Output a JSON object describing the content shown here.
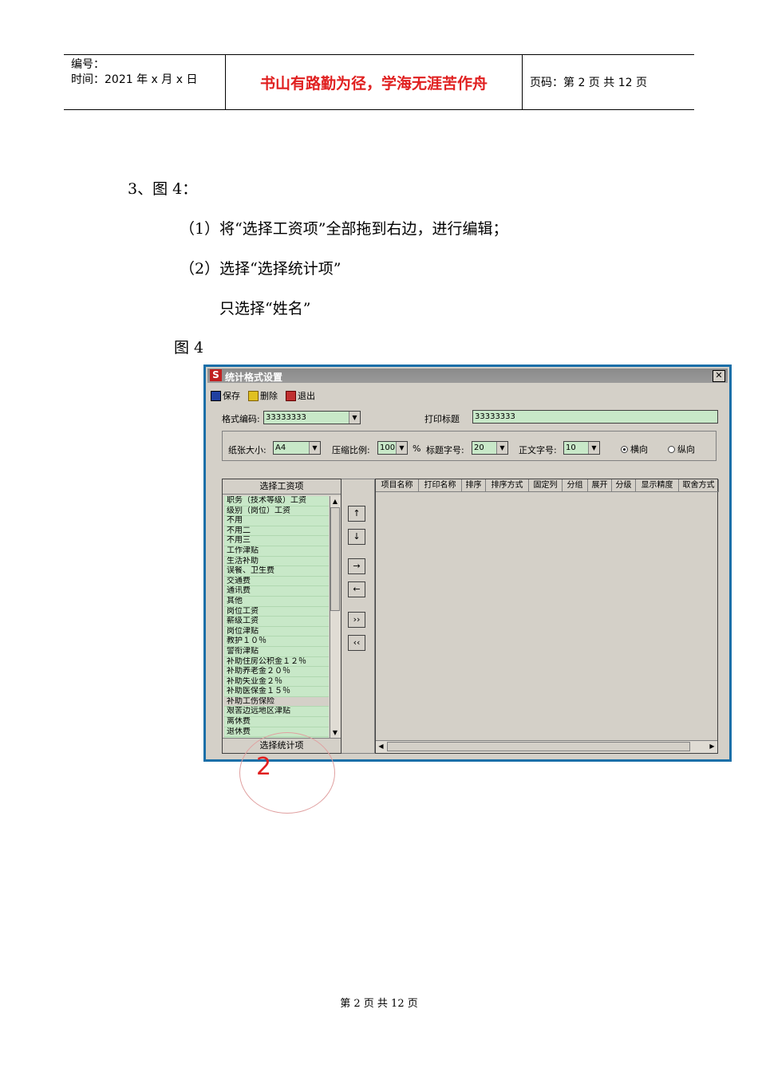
{
  "header": {
    "number_label": "编号：",
    "date_label": "时间：2021 年 x 月 x 日",
    "motto": "书山有路勤为径，学海无涯苦作舟",
    "page_info": "页码：第 2 页  共 12 页"
  },
  "content": {
    "step_title": "3、图 4：",
    "item1": "（1）将“选择工资项”全部拖到右边，进行编辑；",
    "item2": "（2）选择“选择统计项”",
    "item3": "只选择“姓名”",
    "figure_label": "图 4"
  },
  "window": {
    "title": "统计格式设置",
    "toolbar": {
      "save": "保存",
      "delete": "删除",
      "exit": "退出"
    },
    "format_code_label": "格式编码:",
    "format_code_value": "33333333",
    "print_title_label": "打印标题",
    "print_title_value": "33333333",
    "paper_size_label": "纸张大小:",
    "paper_size_value": "A4",
    "zoom_label": "压缩比例:",
    "zoom_value": "100",
    "zoom_unit": "%",
    "title_font_label": "标题字号:",
    "title_font_value": "20",
    "body_font_label": "正文字号:",
    "body_font_value": "10",
    "orientation_landscape": "横向",
    "orientation_portrait": "纵向",
    "left_panel_title": "选择工资项",
    "left_panel_footer": "选择统计项",
    "wage_items": [
      "职务（技术等级）工资",
      "级别（岗位）工资",
      "不用",
      "不用二",
      "不用三",
      "工作津贴",
      "生活补助",
      "误餐、卫生费",
      "交通费",
      "通讯费",
      "其他",
      "岗位工资",
      "薪级工资",
      "岗位津贴",
      "教护１０％",
      "警衔津贴",
      "补助住房公积金１２％",
      "补助养老金２０％",
      "补助失业金２％",
      "补助医保金１５％",
      "补助工伤保险",
      "艰苦边远地区津贴",
      "离休费",
      "退休费"
    ],
    "move_buttons": {
      "up": "↑",
      "down": "↓",
      "right": "→",
      "left": "←",
      "all_right": "››",
      "all_left": "‹‹"
    },
    "grid_columns": [
      "项目名称",
      "打印名称",
      "排序",
      "排序方式",
      "固定列",
      "分组",
      "展开",
      "分级",
      "显示精度",
      "取舍方式"
    ]
  },
  "stamp_number": "2",
  "footer": "第  2  页  共  12  页"
}
